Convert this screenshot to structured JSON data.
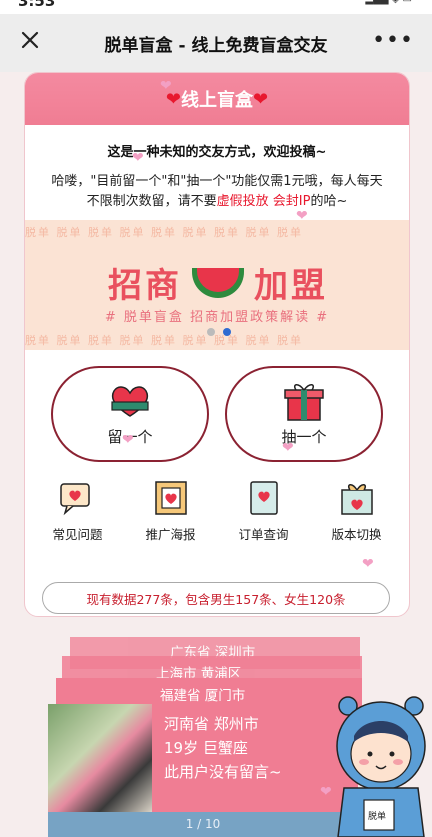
{
  "status_bar": {
    "time": "3:53",
    "indicators": "▂▄▆ ◈ ▭"
  },
  "nav": {
    "title": "脱单盲盒 - 线上免费盲盒交友",
    "close_icon": "close-icon",
    "more_icon": "more-icon"
  },
  "card": {
    "header_title": "线上盲盒",
    "heart_left": "❤",
    "heart_right": "❤",
    "intro": "这是一种未知的交友方式，欢迎投稿~",
    "desc_part1": "哈喽，\"目前留一个\"和\"抽一个\"功能仅需1元哦，每人每天不限制次数留，请不要",
    "desc_red1": "虚假投放",
    "desc_space": " ",
    "desc_red2": "会封IP",
    "desc_part2": "的哈~"
  },
  "banner": {
    "title_left": "招商",
    "title_right": "加盟",
    "subtitle": "# 脱单盲盒 招商加盟政策解读 #",
    "watermark": "脱单 脱单 脱单 脱单 脱单 脱单 脱单 脱单 脱单",
    "slide_count": 2,
    "active_slide": 2
  },
  "actions": {
    "leave_one": "留一个",
    "draw_one": "抽一个"
  },
  "menu": [
    {
      "label": "常见问题",
      "icon": "chat-heart-icon"
    },
    {
      "label": "推广海报",
      "icon": "film-heart-icon"
    },
    {
      "label": "订单查询",
      "icon": "card-heart-icon"
    },
    {
      "label": "版本切换",
      "icon": "gift-heart-icon"
    }
  ],
  "stats_text": "现有数据277条，包含男生157条、女生120条",
  "stack_cards": [
    {
      "line": "广东省 深圳市"
    },
    {
      "line": "上海市 黄浦区"
    },
    {
      "line": "福建省 厦门市"
    }
  ],
  "profile": {
    "location": "河南省 郑州市",
    "age_sign": "19岁 巨蟹座",
    "message": "此用户没有留言~"
  },
  "pager": "1 / 10",
  "mascot_label": "脱单",
  "colors": {
    "accent": "#f07d93",
    "red": "#e8182e",
    "pill_border": "#8b2232",
    "pager": "#77a3c4"
  }
}
